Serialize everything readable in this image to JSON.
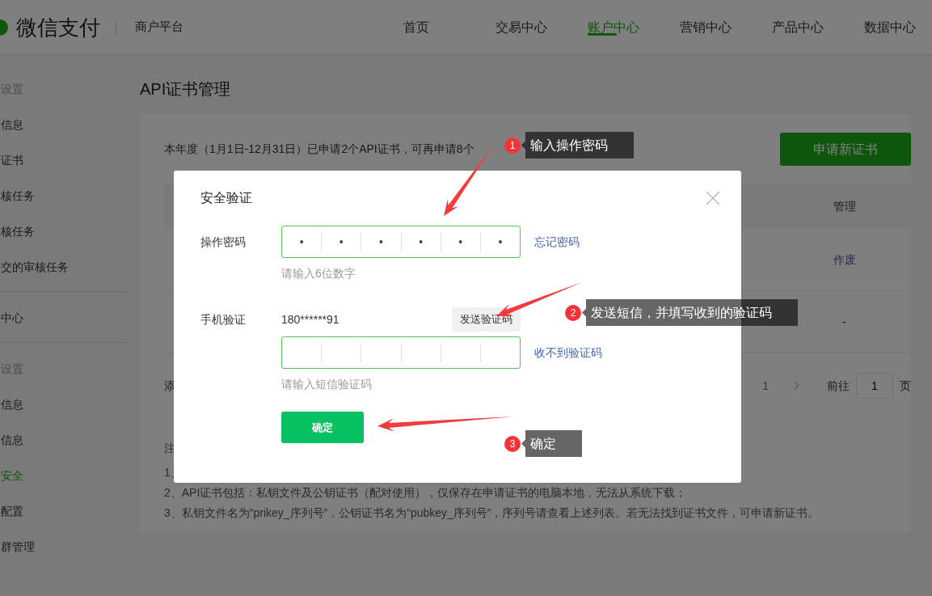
{
  "header": {
    "logo_text": "微信支付",
    "platform": "商户平台",
    "nav": [
      {
        "label": "首页",
        "selected": false
      },
      {
        "label": "交易中心",
        "selected": false
      },
      {
        "label": "账户中心",
        "selected": true
      },
      {
        "label": "营销中心",
        "selected": false
      },
      {
        "label": "产品中心",
        "selected": false
      },
      {
        "label": "数据中心",
        "selected": false
      }
    ]
  },
  "sidebar": {
    "groups": [
      {
        "items": [
          {
            "kind": "heading",
            "label": "设置",
            "selected": false
          },
          {
            "kind": "item",
            "label": "信息",
            "selected": false
          },
          {
            "kind": "item",
            "label": "证书",
            "selected": false
          },
          {
            "kind": "item",
            "label": "核任务",
            "selected": false
          },
          {
            "kind": "item",
            "label": "核任务",
            "selected": false
          },
          {
            "kind": "item",
            "label": "交的审核任务",
            "selected": false
          }
        ]
      },
      {
        "items": [
          {
            "kind": "item",
            "label": "中心",
            "selected": false
          }
        ]
      },
      {
        "items": [
          {
            "kind": "heading",
            "label": "设置",
            "selected": false
          },
          {
            "kind": "item",
            "label": "信息",
            "selected": false
          },
          {
            "kind": "item",
            "label": "信息",
            "selected": false
          },
          {
            "kind": "item",
            "label": "安全",
            "selected": true
          },
          {
            "kind": "item",
            "label": "配置",
            "selected": false
          },
          {
            "kind": "item",
            "label": "群管理",
            "selected": false
          }
        ]
      }
    ]
  },
  "page": {
    "title": "API证书管理",
    "quota_text": "本年度（1月1日-12月31日）已申请2个API证书，可再申请8个",
    "apply_button": "申请新证书",
    "table": {
      "action_header": "管理",
      "rows": [
        {
          "kind": "link",
          "action": "作废"
        },
        {
          "kind": "text",
          "action": "-"
        }
      ]
    },
    "pagination": {
      "fragment": "添",
      "pages": [
        {
          "label": "1",
          "selected": true
        }
      ],
      "goto_label": "前往",
      "goto_value": "1",
      "page_suffix": "页"
    },
    "notes": [
      "注",
      "1、",
      "2、API证书包括：私钥文件及公钥证书（配对使用），仅保存在申请证书的电脑本地，无法从系统下载；",
      "3、私钥文件名为“prikey_序列号”，公钥证书名为“pubkey_序列号”，序列号请查看上述列表。若无法找到证书文件，可申请新证书。"
    ]
  },
  "dialog": {
    "title": "安全验证",
    "password": {
      "label": "操作密码",
      "digits": [
        "•",
        "•",
        "•",
        "•",
        "•",
        "•"
      ],
      "link": "忘记密码",
      "hint": "请输入6位数字"
    },
    "phone": {
      "label": "手机验证",
      "number": "180******91",
      "send_button": "发送验证码",
      "link": "收不到验证码",
      "hint": "请输入短信验证码"
    },
    "confirm_button": "确定"
  },
  "annotations": [
    {
      "number": "1",
      "text": "输入操作密码"
    },
    {
      "number": "2",
      "text": "发送短信，并填写收到的验证码"
    },
    {
      "number": "3",
      "text": "确定"
    }
  ]
}
